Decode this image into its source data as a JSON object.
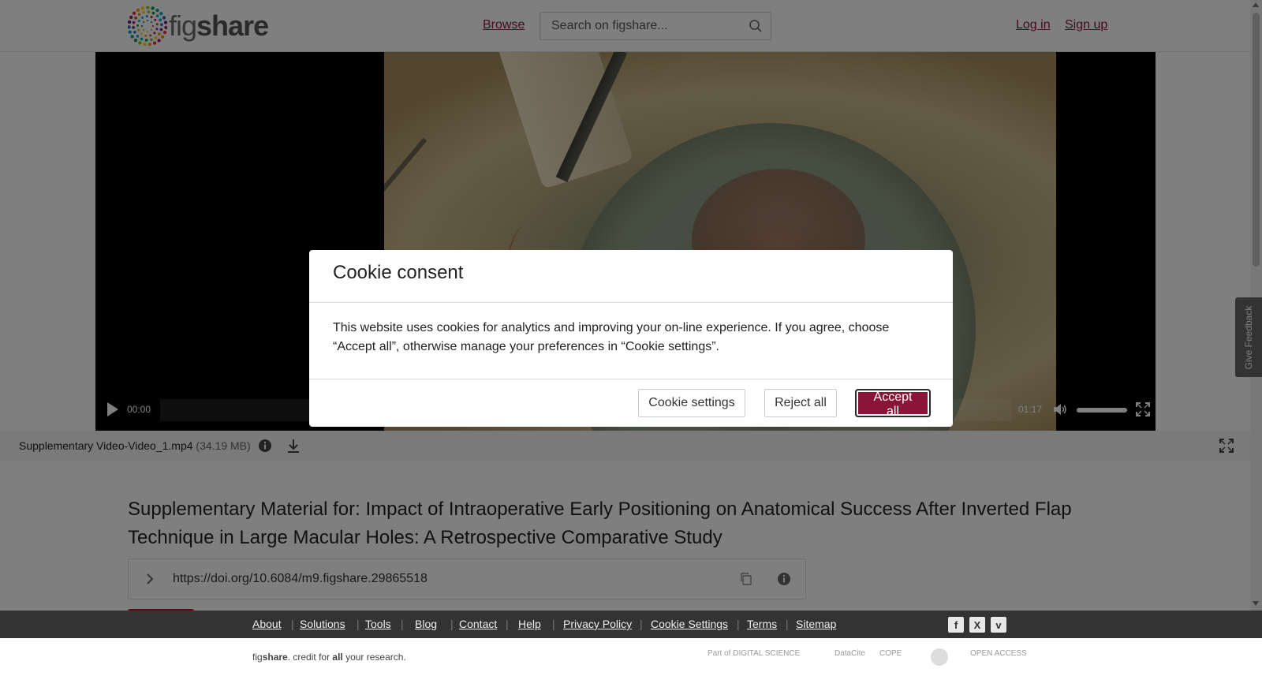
{
  "header": {
    "logo_text_light": "fig",
    "logo_text_bold": "share",
    "browse": "Browse",
    "search_placeholder": "Search on figshare...",
    "login": "Log in",
    "signup": "Sign up"
  },
  "player": {
    "current_time": "00:00",
    "duration": "01:17",
    "volume_level": 1.0
  },
  "file": {
    "name": "Supplementary Video-Video_1.mp4",
    "size": "(34.19 MB)"
  },
  "article": {
    "title": "Supplementary Material for: Impact of Intraoperative Early Positioning on Anatomical Success After Inverted Flap Technique in Large Macular Holes: A Retrospective Comparative Study",
    "doi": "https://doi.org/10.6084/m9.figshare.29865518"
  },
  "feedback": "Give Feedback",
  "footer": {
    "links": [
      "About",
      "Solutions",
      "Tools",
      "Blog",
      "Contact",
      "Help",
      "Privacy Policy",
      "Cookie Settings",
      "Terms",
      "Sitemap"
    ],
    "tagline_pre": "fig",
    "tagline_bold": "share",
    "tagline_mid": ". credit for ",
    "tagline_all": "all",
    "tagline_post": " your research.",
    "partners": [
      "Part of DIGITAL SCIENCE",
      "DataCite",
      "COPE",
      "",
      "OPEN ACCESS"
    ],
    "social": [
      "f",
      "X",
      "v"
    ]
  },
  "cookie": {
    "title": "Cookie consent",
    "body": "This website uses cookies for analytics and improving your on-line experience. If you agree, choose “Accept all”, otherwise manage your preferences in “Cookie settings”.",
    "settings": "Cookie settings",
    "reject": "Reject all",
    "accept": "Accept all"
  },
  "colors": {
    "brand": "#8a1538",
    "footer_bg": "#333333"
  }
}
